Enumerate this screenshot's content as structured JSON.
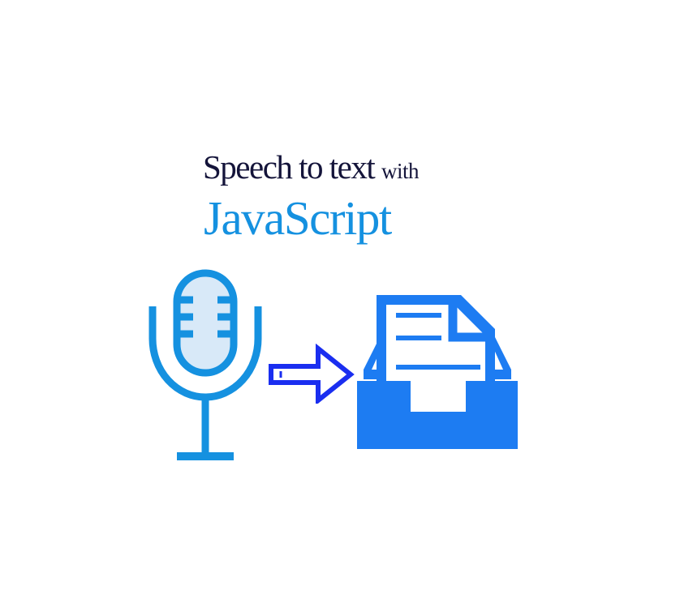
{
  "heading": {
    "main": "Speech to text ",
    "suffix": "with",
    "language": "JavaScript"
  },
  "icons": {
    "microphone": "microphone-icon",
    "arrow": "right-arrow-icon",
    "document": "document-tray-icon"
  },
  "colors": {
    "heading_text": "#14143a",
    "language_text": "#1591e0",
    "microphone_stroke": "#1591e0",
    "microphone_fill": "#d8e9f8",
    "arrow": "#1a2ef0",
    "document": "#1d7cf2"
  }
}
